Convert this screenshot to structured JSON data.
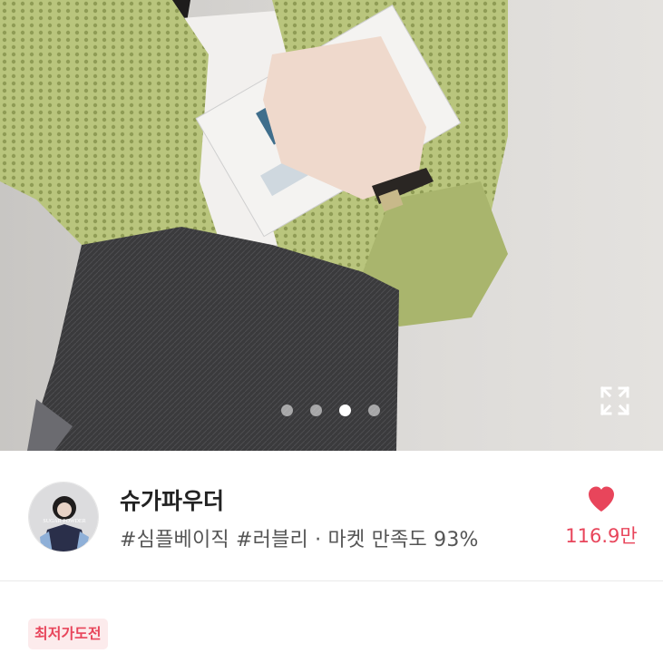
{
  "gallery": {
    "image_label": "product-photo",
    "slide_count": 4,
    "active_slide": 3
  },
  "shop": {
    "name": "슈가파우더",
    "tags": "#심플베이직 #러블리 · 마켓 만족도 93%",
    "avatar_text": "SUGAR POWDER",
    "likes": "116.9만"
  },
  "badge": {
    "label": "최저가도전"
  },
  "colors": {
    "accent": "#e8455b",
    "badge_bg": "#fcebec"
  },
  "icons": {
    "expand": "expand-icon",
    "like": "heart-icon"
  }
}
